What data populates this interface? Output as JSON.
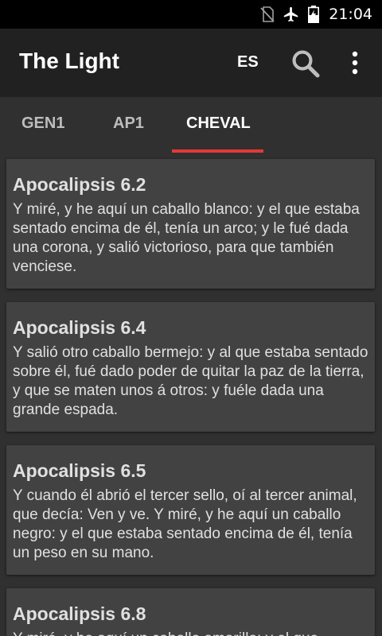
{
  "status_bar": {
    "time": "21:04",
    "icons": [
      "no-sim-icon",
      "airplane-mode-icon",
      "battery-charging-icon"
    ]
  },
  "app_bar": {
    "title": "The Light",
    "language": "ES",
    "actions": [
      "search-icon",
      "overflow-menu-icon"
    ]
  },
  "tabs": [
    {
      "label": "GEN1",
      "active": false
    },
    {
      "label": "AP1",
      "active": false
    },
    {
      "label": "CHEVAL",
      "active": true
    }
  ],
  "colors": {
    "background": "#303030",
    "app_bar": "#212121",
    "card": "#424242",
    "accent": "#e53935",
    "status_bar": "#000000"
  },
  "verses": [
    {
      "reference": "Apocalipsis 6.2",
      "text": "Y miré, y he aquí un caballo blanco: y el que estaba sentado encima de él, tenía un arco; y le fué dada una corona, y salió victorioso, para que también venciese."
    },
    {
      "reference": "Apocalipsis 6.4",
      "text": "Y salió otro caballo bermejo: y al que estaba sentado sobre él, fué dado poder de quitar la paz de la tierra, y que se maten unos á otros: y fuéle dada una grande espada."
    },
    {
      "reference": "Apocalipsis 6.5",
      "text": "Y cuando él abrió el tercer sello, oí al tercer animal, que decía: Ven y ve. Y miré, y he aquí un caballo negro: y el que estaba sentado encima de él, tenía un peso en su mano."
    },
    {
      "reference": "Apocalipsis 6.8",
      "text": "Y miré, y he aquí un caballo amarillo: y el que"
    }
  ]
}
